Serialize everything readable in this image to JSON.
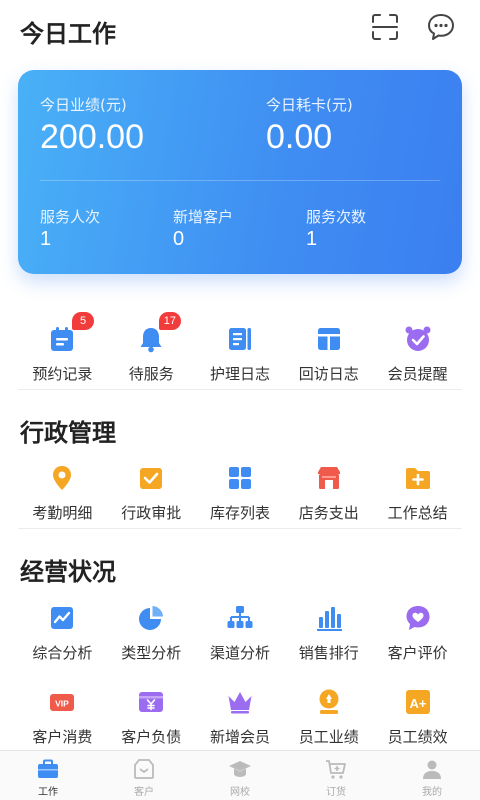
{
  "header": {
    "title": "今日工作"
  },
  "summary": {
    "perf_label": "今日业绩(元)",
    "perf_value": "200.00",
    "card_label": "今日耗卡(元)",
    "card_value": "0.00",
    "stats": [
      {
        "label": "服务人次",
        "value": "1"
      },
      {
        "label": "新增客户",
        "value": "0"
      },
      {
        "label": "服务次数",
        "value": "1"
      }
    ]
  },
  "quick": [
    {
      "label": "预约记录",
      "icon": "calendar-icon",
      "badge": "5"
    },
    {
      "label": "待服务",
      "icon": "bell-icon",
      "badge": "17"
    },
    {
      "label": "护理日志",
      "icon": "notebook-icon"
    },
    {
      "label": "回访日志",
      "icon": "layout-icon"
    },
    {
      "label": "会员提醒",
      "icon": "alarm-icon"
    }
  ],
  "admin": {
    "title": "行政管理",
    "items": [
      {
        "label": "考勤明细",
        "icon": "location-pin-icon"
      },
      {
        "label": "行政审批",
        "icon": "approval-icon"
      },
      {
        "label": "库存列表",
        "icon": "grid-icon"
      },
      {
        "label": "店务支出",
        "icon": "shop-icon"
      },
      {
        "label": "工作总结",
        "icon": "folder-icon"
      }
    ]
  },
  "business": {
    "title": "经营状况",
    "items": [
      {
        "label": "综合分析",
        "icon": "trend-icon"
      },
      {
        "label": "类型分析",
        "icon": "pie-icon"
      },
      {
        "label": "渠道分析",
        "icon": "org-chart-icon"
      },
      {
        "label": "销售排行",
        "icon": "bar-chart-icon"
      },
      {
        "label": "客户评价",
        "icon": "heart-chat-icon"
      },
      {
        "label": "客户消费",
        "icon": "vip-icon",
        "badge_text": "VIP"
      },
      {
        "label": "客户负债",
        "icon": "yen-card-icon"
      },
      {
        "label": "新增会员",
        "icon": "crown-icon"
      },
      {
        "label": "员工业绩",
        "icon": "medal-icon"
      },
      {
        "label": "员工绩效",
        "icon": "grade-icon",
        "badge_text": "A+"
      }
    ]
  },
  "tabs": [
    {
      "label": "工作",
      "icon": "briefcase-icon",
      "active": true
    },
    {
      "label": "客户",
      "icon": "customer-icon"
    },
    {
      "label": "网校",
      "icon": "graduation-cap-icon"
    },
    {
      "label": "订货",
      "icon": "cart-icon"
    },
    {
      "label": "我的",
      "icon": "user-icon"
    }
  ],
  "colors": {
    "accent": "#3f8df2",
    "badge": "#f23b3b",
    "orange": "#f5a623",
    "purple": "#9b6cf0"
  }
}
